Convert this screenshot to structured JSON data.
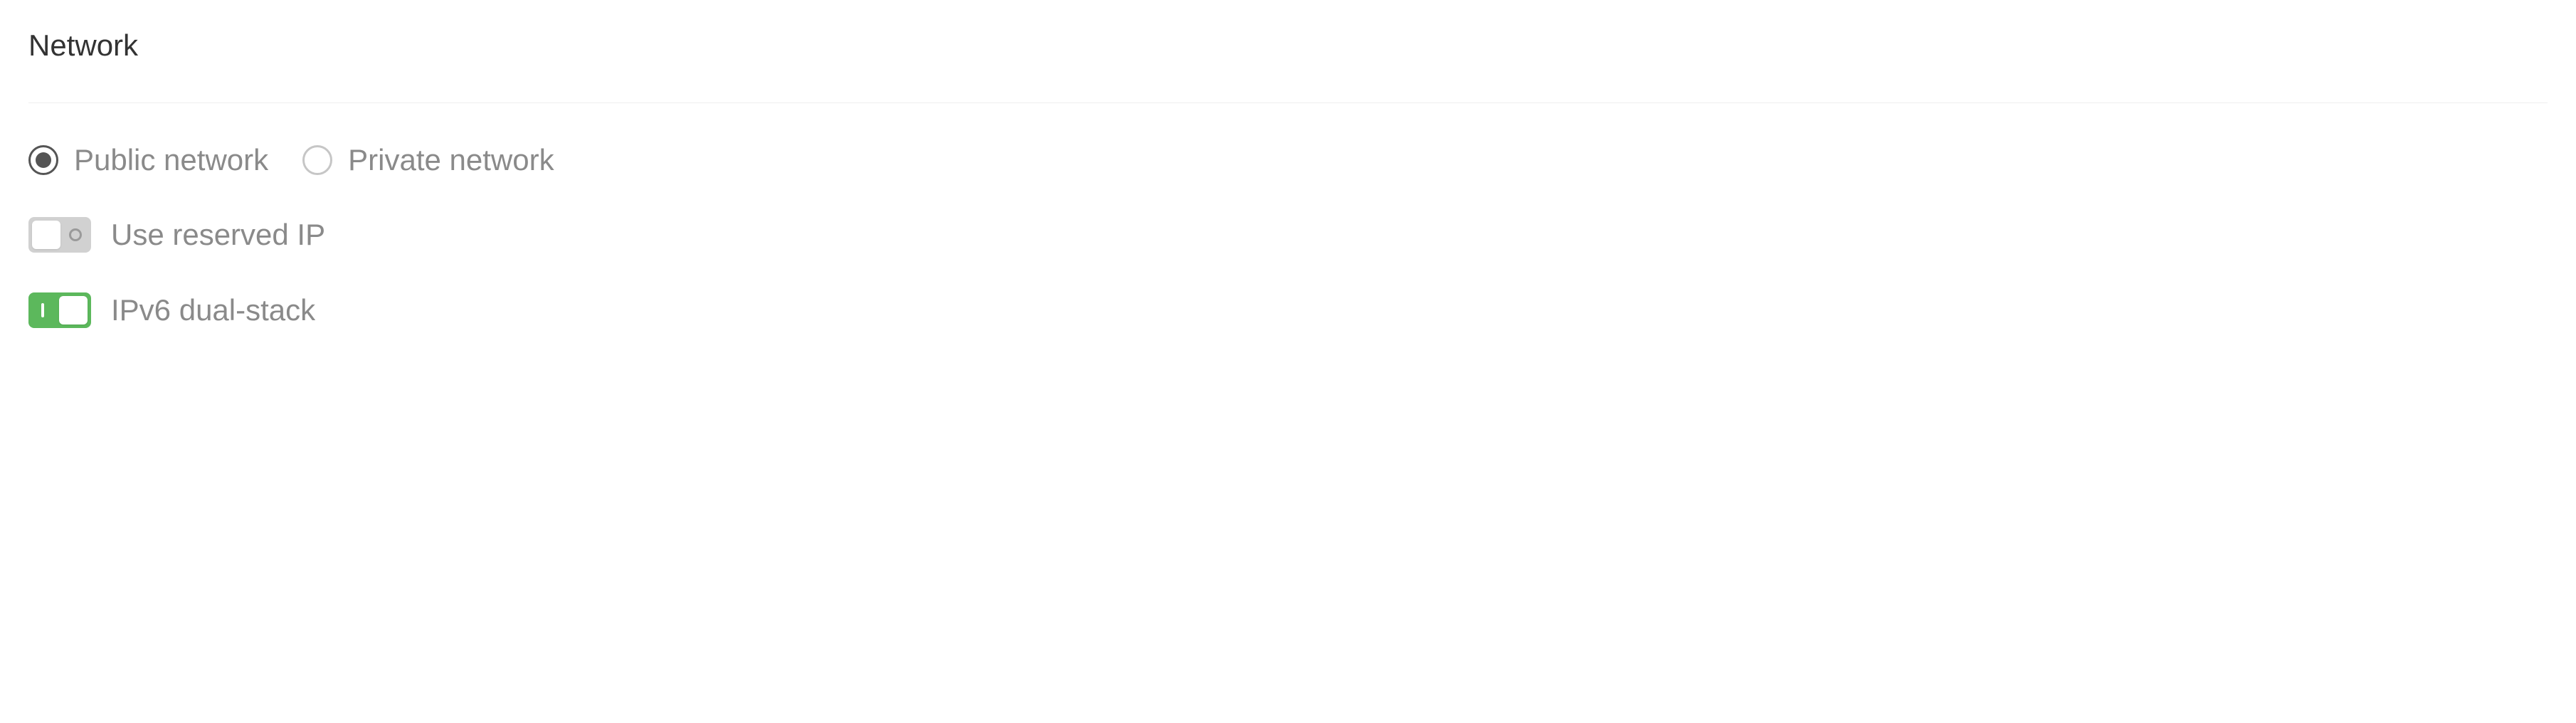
{
  "section": {
    "title": "Network"
  },
  "network_type": {
    "options": {
      "public": {
        "label": "Public network",
        "selected": true
      },
      "private": {
        "label": "Private network",
        "selected": false
      }
    }
  },
  "reserved_ip": {
    "label": "Use reserved IP",
    "enabled": false
  },
  "ipv6_dual_stack": {
    "label": "IPv6 dual-stack",
    "enabled": true
  }
}
